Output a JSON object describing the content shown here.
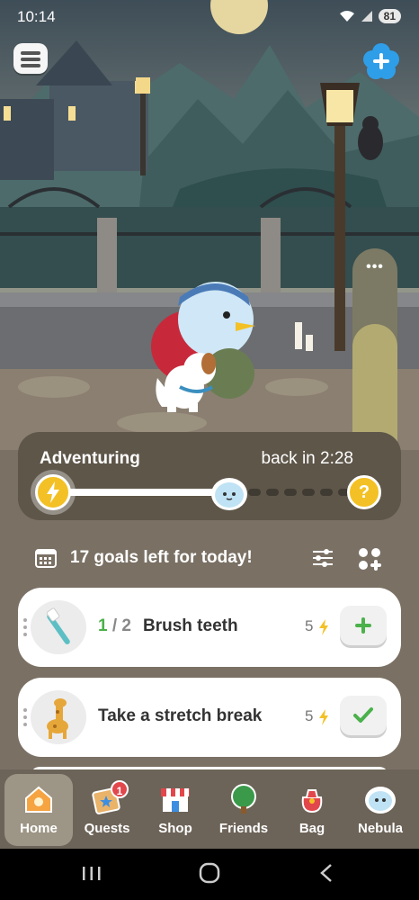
{
  "status_bar": {
    "time": "10:14",
    "battery": "81"
  },
  "adventure": {
    "title": "Adventuring",
    "return_time": "back in 2:28",
    "progress_fraction": 0.62,
    "mystery_label": "?"
  },
  "goals_header": {
    "text": "17 goals left for today!"
  },
  "goals": [
    {
      "progress_done": "1",
      "progress_sep": " / ",
      "progress_total": "2",
      "title": "Brush teeth",
      "reward": "5",
      "action": "plus",
      "icon": "toothbrush-icon"
    },
    {
      "title": "Take a stretch break",
      "reward": "5",
      "action": "check",
      "icon": "giraffe-icon"
    }
  ],
  "nav": {
    "items": [
      {
        "label": "Home",
        "icon": "house-icon",
        "active": true
      },
      {
        "label": "Quests",
        "icon": "quest-scroll-icon",
        "badge": "1"
      },
      {
        "label": "Shop",
        "icon": "shop-icon"
      },
      {
        "label": "Friends",
        "icon": "tree-icon"
      },
      {
        "label": "Bag",
        "icon": "bag-icon"
      },
      {
        "label": "Nebula",
        "icon": "nebula-icon"
      }
    ]
  },
  "colors": {
    "accent_yellow": "#f3c125",
    "check_green": "#4bb14b",
    "card_bg": "#5e5649",
    "nav_bg": "#6d6459"
  }
}
